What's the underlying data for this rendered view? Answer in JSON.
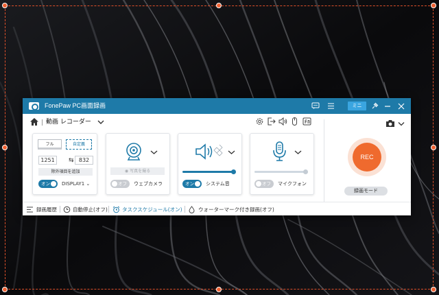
{
  "window": {
    "title": "FonePaw PC画面録画",
    "mini_label": "ミニ",
    "accent": "#1e7aa8",
    "rec_color": "#ef6a2e"
  },
  "header": {
    "mode_title": "動画 レコーダー"
  },
  "area_panel": {
    "full_label": "フル",
    "custom_label": "自定義",
    "width": "1251",
    "height": "832",
    "exclude_label": "除外項目を追加",
    "toggle_label": "オン",
    "display_label": "DISPLAY1"
  },
  "webcam_panel": {
    "photo_label": "写真を撮る",
    "toggle_label": "オフ",
    "name": "ウェブカメラ"
  },
  "system_sound_panel": {
    "toggle_label": "オン",
    "name": "システム音",
    "volume": 0.95
  },
  "mic_panel": {
    "toggle_label": "オフ",
    "name": "マイクフォン",
    "volume": 0.95
  },
  "record": {
    "rec_label": "REC",
    "mode_label": "録画モード"
  },
  "footer": {
    "history": "録画履歴",
    "auto_stop": "自動停止(オフ)",
    "task_schedule": "タスクスケジュール(オン)",
    "watermark": "ウォーターマーク付き録画(オフ)"
  },
  "icons": {
    "logo": "camera-logo-icon",
    "home": "home-icon",
    "settings": "gear-icon",
    "export": "export-icon",
    "speaker": "speaker-icon",
    "mouse": "mouse-icon",
    "fn": "fn-key-icon",
    "camera": "camera-icon"
  }
}
